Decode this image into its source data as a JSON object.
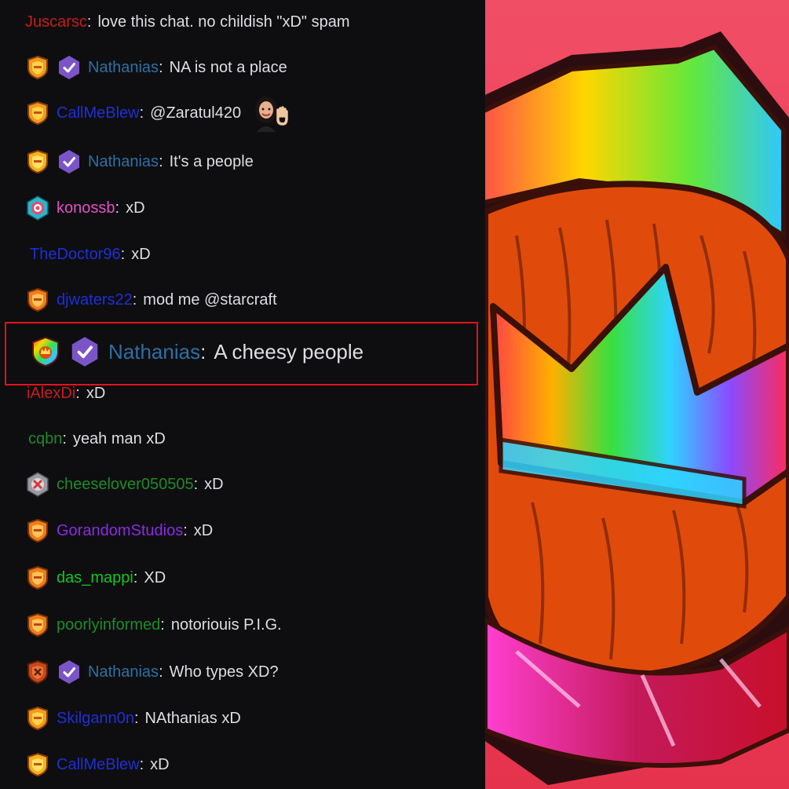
{
  "chat": {
    "messages": [
      {
        "user": "Juscarsc",
        "color": "#c81c1c",
        "text": "love this chat. no childish \"xD\" spam"
      },
      {
        "user": "Nathanias",
        "color": "#2e6fa4",
        "text": "NA is not a place",
        "badges": [
          "gold-shield-icon",
          "verified-icon"
        ]
      },
      {
        "user": "CallMeBlew",
        "color": "#1f2fd6",
        "text": "@Zaratul420",
        "badges": [
          "gold-shield-icon"
        ],
        "emote": "waving-woman-emote"
      },
      {
        "user": "Nathanias",
        "color": "#2e6fa4",
        "text": "It's a people",
        "badges": [
          "gold-shield-icon",
          "verified-icon"
        ]
      },
      {
        "user": "konossb",
        "color": "#e352c8",
        "text": "xD",
        "badges": [
          "cyan-target-icon"
        ]
      },
      {
        "user": "TheDoctor96",
        "color": "#1f2fd6",
        "text": "xD"
      },
      {
        "user": "djwaters22",
        "color": "#1f2fd6",
        "text": "mod me @starcraft",
        "badges": [
          "orange-shield-icon"
        ]
      },
      {
        "user": "iAlexDi",
        "color": "#c81c1c",
        "text": "xD"
      },
      {
        "user": "cqbn",
        "color": "#1f8a2a",
        "text": "yeah man xD"
      },
      {
        "user": "cheeselover050505",
        "color": "#1f8a2a",
        "text": "xD",
        "badges": [
          "silver-shield-icon"
        ]
      },
      {
        "user": "GorandomStudios",
        "color": "#8a2be2",
        "text": "xD",
        "badges": [
          "orange-shield-icon"
        ]
      },
      {
        "user": "das_mappi",
        "color": "#12c61f",
        "text": "XD",
        "badges": [
          "orange-shield-icon"
        ]
      },
      {
        "user": "poorlyinformed",
        "color": "#1f8a2a",
        "text": "notoriouis P.I.G.",
        "badges": [
          "orange-shield-icon"
        ]
      },
      {
        "user": "Nathanias",
        "color": "#2e6fa4",
        "text": "Who types XD?",
        "badges": [
          "red-shield-icon",
          "verified-icon"
        ]
      },
      {
        "user": "Skilgann0n",
        "color": "#1f2fd6",
        "text": "NAthanias xD",
        "badges": [
          "gold-shield-icon"
        ]
      },
      {
        "user": "CallMeBlew",
        "color": "#1f2fd6",
        "text": "xD",
        "badges": [
          "gold-shield-icon"
        ]
      }
    ],
    "highlight": {
      "user": "Nathanias",
      "color": "#2e6fa4",
      "text": "A cheesy people",
      "badges": [
        "rainbow-shield-icon",
        "verified-icon"
      ]
    },
    "colon": ":"
  },
  "artwork": {
    "subject": "rainbow-crown-emblem-icon",
    "background_color": "#ef4660",
    "accent_colors": [
      "#ff2a2a",
      "#ffd600",
      "#37e03d",
      "#2fd3ff",
      "#b43cff",
      "#e04b0b"
    ]
  },
  "colors": {
    "chat_bg": "#0e0e10",
    "text": "#dedee3",
    "highlight_border": "#e3131b"
  }
}
